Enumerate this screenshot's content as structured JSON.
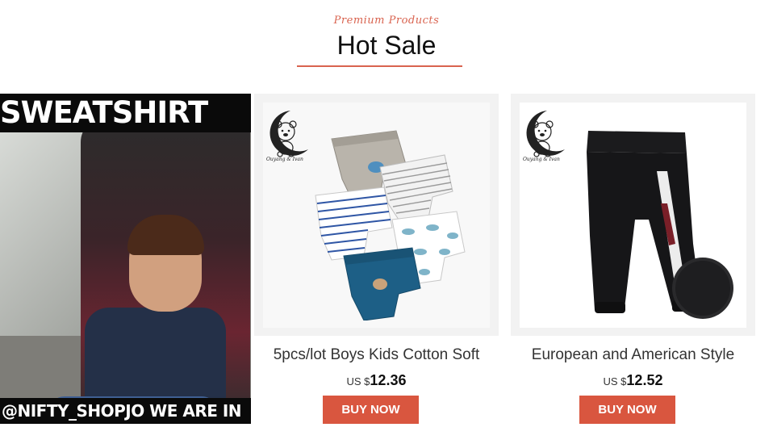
{
  "header": {
    "subtitle": "Premium Products",
    "title": "Hot Sale"
  },
  "colors": {
    "accent": "#d9563f",
    "underline": "#d9634f"
  },
  "featured": {
    "top_caption": "SWEATSHIRT",
    "bottom_caption": "@NIFTY_SHOPJO WE ARE IN"
  },
  "products": [
    {
      "brand": "Ouyang & Ivan",
      "name": "5pcs/lot Boys Kids Cotton Soft",
      "currency": "US $",
      "price": "12.36",
      "button_label": "BUY NOW",
      "image_icon": "boxer-shorts-icon"
    },
    {
      "brand": "Ouyang & Ivan",
      "name": "European and American Style",
      "currency": "US $",
      "price": "12.52",
      "button_label": "BUY NOW",
      "image_icon": "jogger-pants-icon"
    }
  ]
}
